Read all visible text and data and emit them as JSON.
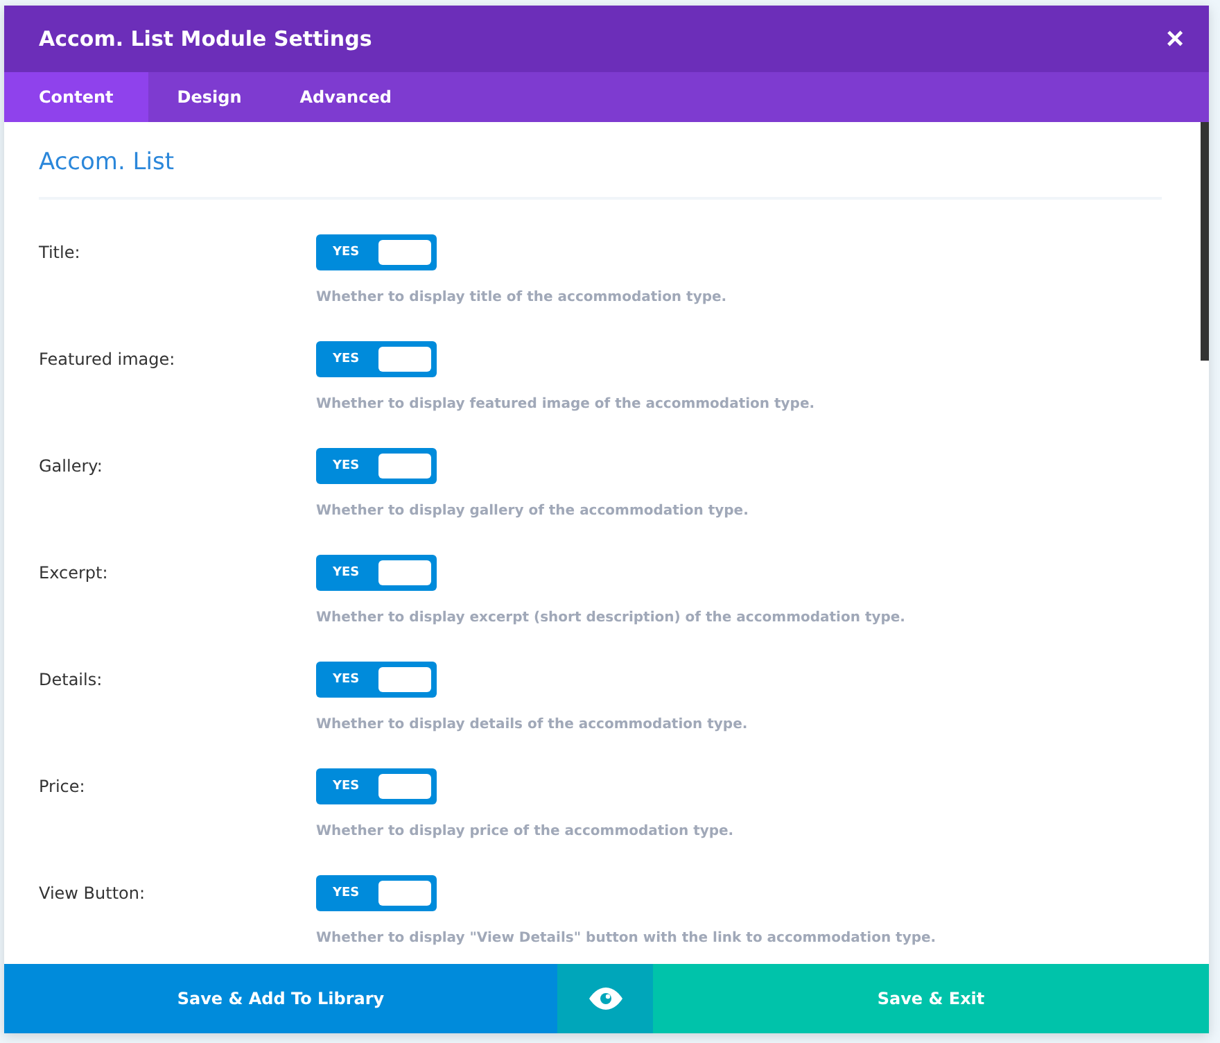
{
  "window": {
    "title": "Accom. List Module Settings",
    "close": "×"
  },
  "tabs": [
    {
      "label": "Content",
      "selected": true
    },
    {
      "label": "Design",
      "selected": false
    },
    {
      "label": "Advanced",
      "selected": false
    }
  ],
  "section": {
    "title": "Accom. List"
  },
  "settings": [
    {
      "label": "Title:",
      "on": true,
      "toggle_text": "YES",
      "description": "Whether to display title of the accommodation type."
    },
    {
      "label": "Featured image:",
      "on": true,
      "toggle_text": "YES",
      "description": "Whether to display featured image of the accommodation type."
    },
    {
      "label": "Gallery:",
      "on": true,
      "toggle_text": "YES",
      "description": "Whether to display gallery of the accommodation type."
    },
    {
      "label": "Excerpt:",
      "on": true,
      "toggle_text": "YES",
      "description": "Whether to display excerpt (short description) of the accommodation type."
    },
    {
      "label": "Details:",
      "on": true,
      "toggle_text": "YES",
      "description": "Whether to display details of the accommodation type."
    },
    {
      "label": "Price:",
      "on": true,
      "toggle_text": "YES",
      "description": "Whether to display price of the accommodation type."
    },
    {
      "label": "View Button:",
      "on": true,
      "toggle_text": "YES",
      "description": "Whether to display \"View Details\" button with the link to accommodation type."
    }
  ],
  "footer": {
    "library_button": "Save & Add To Library",
    "exit_button": "Save & Exit"
  }
}
